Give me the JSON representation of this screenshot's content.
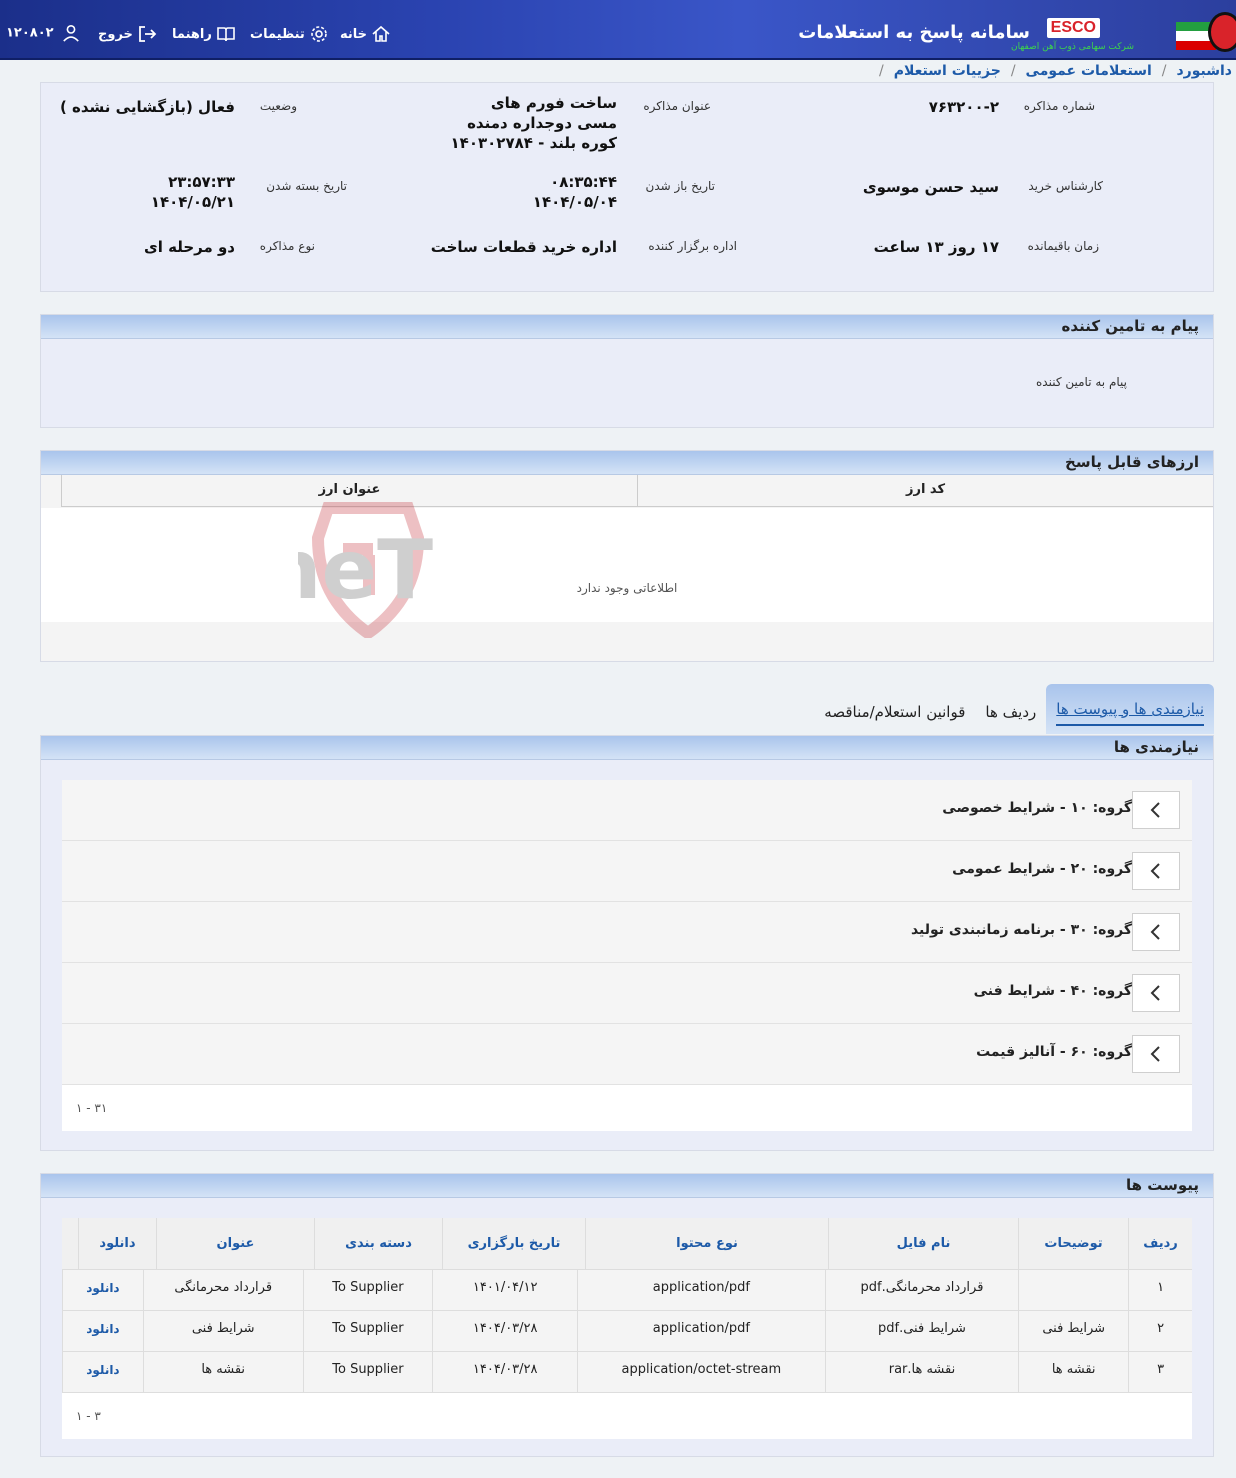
{
  "header": {
    "user_id": "۱۲۰۸۰۲",
    "logout": "خروج",
    "guide": "راهنما",
    "settings": "تنظیمات",
    "home": "خانه",
    "system_title": "سامانه پاسخ به استعلامات",
    "logo_text": "ESCO",
    "logo_sub": "شرکت سهامی ذوب آهن اصفهان"
  },
  "breadcrumb": [
    "داشبورد",
    "استعلامات عمومی",
    "جزییات استعلام"
  ],
  "details": {
    "negotiation_number_label": "شماره مذاکره",
    "negotiation_number": "۷۶۳۲۰۰-۲",
    "negotiation_title_label": "عنوان مذاکره",
    "negotiation_title": "ساخت فورم های مسی دوجداره دمنده کوره بلند - ۱۴۰۳۰۲۷۸۴",
    "status_label": "وضعیت",
    "status": "فعال (بازگشایی نشده )",
    "buyer_label": "کارشناس خرید",
    "buyer": "سید حسن موسوی",
    "open_date_label": "تاریخ باز شدن",
    "open_time": "۰۸:۳۵:۴۴",
    "open_date": "۱۴۰۴/۰۵/۰۴",
    "close_date_label": "تاریخ بسته شدن",
    "close_time": "۲۳:۵۷:۳۳",
    "close_date": "۱۴۰۴/۰۵/۲۱",
    "remaining_label": "زمان باقیمانده",
    "remaining": "۱۷ روز ۱۳ ساعت",
    "organizer_label": "اداره برگزار کننده",
    "organizer": "اداره خرید قطعات ساخت",
    "type_label": "نوع مذاکره",
    "type": "دو مرحله ای"
  },
  "supplier_message": {
    "title": "پیام به تامین کننده",
    "text": "پیام به تامین کننده"
  },
  "currencies": {
    "title": "ارزهای قابل پاسخ",
    "col_code": "کد ارز",
    "col_title": "عنوان ارز",
    "empty": "اطلاعاتی وجود ندارد"
  },
  "tabs": [
    "نیازمندی ها و پیوست ها",
    "ردیف ها",
    "قوانین استعلام/مناقصه"
  ],
  "requirements": {
    "title": "نیازمندی ها",
    "groups": [
      "گروه: ۱۰ - شرایط خصوصی",
      "گروه: ۲۰ - شرایط عمومی",
      "گروه: ۳۰ - برنامه زمانبندی تولید",
      "گروه: ۴۰ - شرایط فنی",
      "گروه: ۶۰ - آنالیز قیمت"
    ],
    "pager": "۱ - ۳۱"
  },
  "attachments": {
    "title": "پیوست ها",
    "columns": [
      "ردیف",
      "توضیحات",
      "نام فایل",
      "نوع محتوا",
      "تاریخ بارگزاری",
      "دسته بندی",
      "عنوان",
      "دانلود"
    ],
    "rows": [
      [
        "۱",
        "",
        "قرارداد محرمانگی.pdf",
        "application/pdf",
        "۱۴۰۱/۰۴/۱۲",
        "To Supplier",
        "قرارداد محرمانگی",
        "دانلود"
      ],
      [
        "۲",
        "شرایط فنی",
        "شرایط فنی.pdf",
        "application/pdf",
        "۱۴۰۴/۰۳/۲۸",
        "To Supplier",
        "شرایط فنی",
        "دانلود"
      ],
      [
        "۳",
        "نقشه ها",
        "نقشه ها.rar",
        "application/octet-stream",
        "۱۴۰۴/۰۳/۲۸",
        "To Supplier",
        "نقشه ها",
        "دانلود"
      ]
    ],
    "pager": "۱ - ۳"
  },
  "watermark": "AriaTender.neT"
}
